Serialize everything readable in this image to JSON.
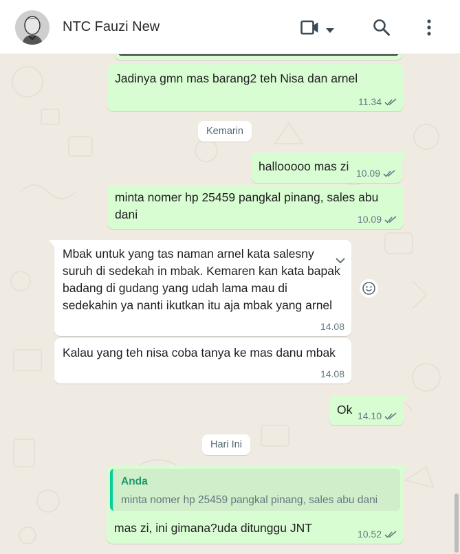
{
  "header": {
    "contact_name": "NTC Fauzi New"
  },
  "icons": {
    "video": "video-call-icon",
    "dropdown": "chevron-down-icon",
    "search": "search-icon",
    "menu": "more-vertical-icon"
  },
  "colors": {
    "outgoing_bubble": "#d9fdd3",
    "incoming_bubble": "#ffffff",
    "chat_background": "#efeae2",
    "quote_author": "#1f9a6a"
  },
  "messages": [
    {
      "direction": "out",
      "text": "Jadinya gmn mas barang2 teh Nisa dan arnel",
      "time": "11.34"
    },
    {
      "type": "date",
      "label": "Kemarin"
    },
    {
      "direction": "out",
      "text": "hallooooo mas zi",
      "time": "10.09"
    },
    {
      "direction": "out",
      "text": "minta nomer hp 25459 pangkal pinang, sales abu dani",
      "time": "10.09"
    },
    {
      "direction": "in",
      "text": "Mbak untuk yang tas naman arnel kata salesnya suruh di sedekah in mbak. Kemaren kan kata bapak badang di gudang yang udah lama mau di sedekahin ya nanti ikutkan itu aja mbak yang arnel",
      "lines": [
        "Mbak untuk yang tas naman arnel kata salesny",
        "suruh di sedekah in mbak. Kemaren kan kata bapak",
        "badang di gudang yang udah lama mau di",
        "sedekahin ya nanti ikutkan itu aja mbak yang arnel"
      ],
      "time": "14.08"
    },
    {
      "direction": "in",
      "text": "Kalau yang teh nisa coba tanya ke mas danu mbak",
      "time": "14.08"
    },
    {
      "direction": "out",
      "text": "Ok",
      "time": "14.10"
    },
    {
      "type": "date",
      "label": "Hari Ini"
    },
    {
      "direction": "out",
      "quote_author": "Anda",
      "quote_text": "minta nomer hp 25459 pangkal pinang, sales abu dani",
      "text": "mas zi, ini gimana?uda ditunggu JNT",
      "time": "10.52"
    }
  ]
}
